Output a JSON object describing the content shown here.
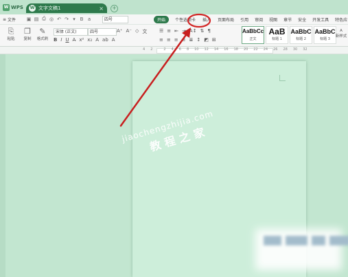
{
  "app": {
    "brand": "WPS"
  },
  "doc_tab": {
    "title": "文字文稿1",
    "close": "×"
  },
  "new_tab": "+",
  "toolbar": {
    "file_menu": "文件",
    "font_size_top": "四号",
    "menu_items": [
      "开始",
      "个性选项卡",
      "插入",
      "页面布局",
      "引用",
      "审阅",
      "视图",
      "章节",
      "安全",
      "开发工具",
      "特色应"
    ],
    "paste_label": "粘贴",
    "copy_label": "复制",
    "format_painter_label": "格式刷",
    "font_name": "宋体 (正文)",
    "font_size": "四号",
    "bold": "B",
    "italic": "I",
    "underline": "U"
  },
  "styles": [
    {
      "sample": "AaBbCcDd",
      "name": "正文"
    },
    {
      "sample": "AaB",
      "name": "标题 1"
    },
    {
      "sample": "AaBbC",
      "name": "标题 2"
    },
    {
      "sample": "AaBbC",
      "name": "标题 3"
    }
  ],
  "new_style_label": "新样式",
  "ruler": {
    "numbers": [
      "4",
      "2",
      "",
      "2",
      "4",
      "6",
      "8",
      "10",
      "12",
      "14",
      "16",
      "18",
      "20",
      "22",
      "24",
      "26",
      "28",
      "30",
      "32"
    ]
  },
  "watermark": {
    "line1": "jiaochengzhijia.com",
    "line2": "教程之家"
  },
  "annotation": {
    "circle_color": "#d22626",
    "arrow_color": "#c81f1f"
  }
}
